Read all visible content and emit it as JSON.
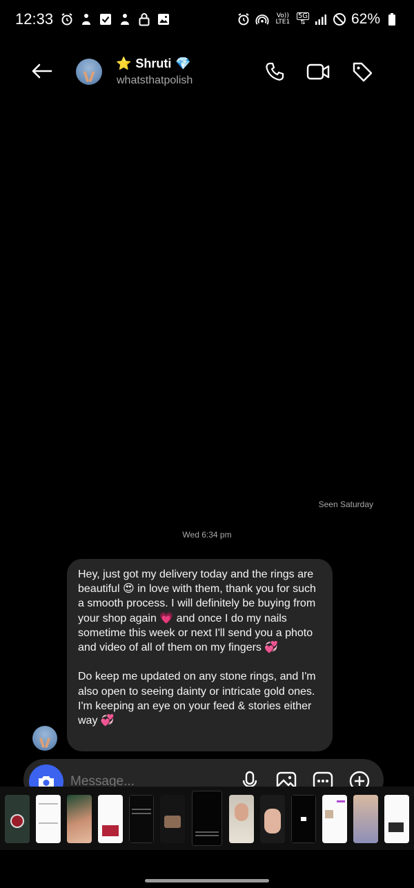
{
  "status_bar": {
    "time": "12:33",
    "network_label": "Vo)) LTE1",
    "network_type": "5G",
    "battery": "62%"
  },
  "header": {
    "contact_name": "Shruti",
    "username": "whatsthatpolish",
    "star_emoji": "⭐",
    "gem_emoji": "💎",
    "icons": [
      "back-arrow-icon",
      "phone-icon",
      "video-camera-icon",
      "tag-icon"
    ]
  },
  "conversation": {
    "seen_label": "Seen Saturday",
    "timestamp": "Wed 6:34 pm",
    "message": {
      "p1": "Hey, just got my delivery today and the rings are beautiful ",
      "e1": "😍",
      "p2": " in love with them, thank you for such a smooth process. I will definitely be buying from your shop again ",
      "e2": "💗",
      "p3": " and once I do my nails sometime this week or next I'll send you a photo and video of all of them on my fingers ",
      "e3": "💞",
      "p4": "\n\nDo keep me updated on any stone rings, and I'm also open to seeing dainty or intricate gold ones. I'm keeping an eye on your feed & stories either way ",
      "e4": "💞"
    }
  },
  "composer": {
    "placeholder": "Message...",
    "icons": [
      "camera-icon",
      "microphone-icon",
      "gallery-icon",
      "sticker-icon",
      "plus-icon"
    ]
  },
  "colors": {
    "background": "#000000",
    "bubble": "#262626",
    "accent_blue": "#3b63f0",
    "muted_text": "#a8a8a8"
  }
}
